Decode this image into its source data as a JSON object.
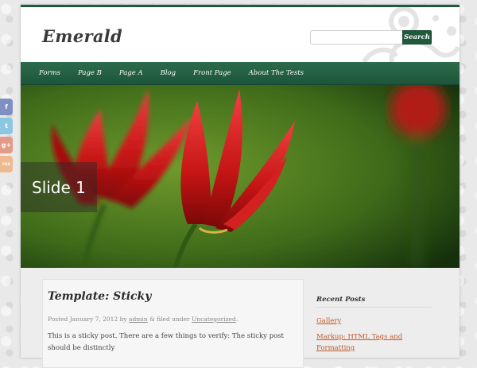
{
  "site": {
    "title": "Emerald"
  },
  "search": {
    "placeholder": "",
    "button_label": "Search"
  },
  "nav": {
    "items": [
      "Forms",
      "Page B",
      "Page A",
      "Blog",
      "Front Page",
      "About The Tests"
    ]
  },
  "slider": {
    "caption": "Slide 1"
  },
  "post": {
    "title": "Template: Sticky",
    "meta": {
      "posted_prefix": "Posted",
      "date": "January 7, 2012",
      "by": "by",
      "author": "admin",
      "filed": "& filed under",
      "category": "Uncategorized",
      "end": "."
    },
    "excerpt": "This is a sticky post. There are a few things to verify: The sticky post should be distinctly"
  },
  "sidebar": {
    "widget_title": "Recent Posts",
    "links": [
      "Gallery",
      "Markup: HTML Tags and Formatting"
    ]
  },
  "social": [
    {
      "icon": "facebook-icon",
      "glyph": "f"
    },
    {
      "icon": "twitter-icon",
      "glyph": "t"
    },
    {
      "icon": "google-plus-icon",
      "glyph": "g+"
    },
    {
      "icon": "rss-icon",
      "glyph": "rss"
    }
  ],
  "colors": {
    "brand_green": "#1f5a3d",
    "link_orange": "#c0592a",
    "background": "#e9e9e9"
  }
}
